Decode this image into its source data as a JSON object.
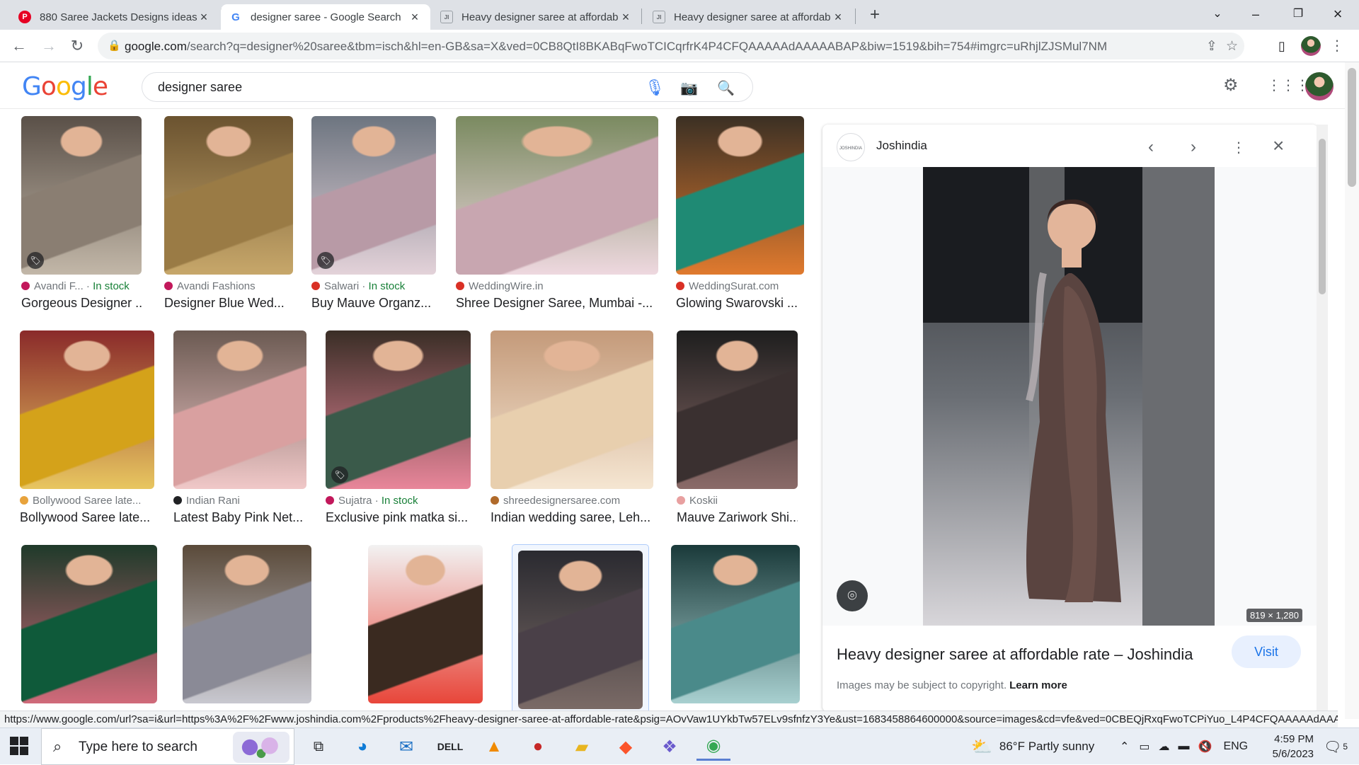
{
  "browser": {
    "tabs": [
      {
        "title": "880 Saree Jackets Designs ideas |",
        "icon": "pinterest-icon",
        "active": false
      },
      {
        "title": "designer saree - Google Search",
        "icon": "google-icon",
        "active": true
      },
      {
        "title": "Heavy designer saree at affordab",
        "icon": "joshindia-icon",
        "active": false
      },
      {
        "title": "Heavy designer saree at affordab",
        "icon": "joshindia-icon",
        "active": false
      }
    ],
    "url_host": "google.com",
    "url_rest": "/search?q=designer%20saree&tbm=isch&hl=en-GB&sa=X&ved=0CB8QtI8BKABqFwoTCICqrfrK4P4CFQAAAAAdAAAAABAP&biw=1519&bih=754#imgrc=uRhjlZJSMul7NM"
  },
  "google": {
    "logo_letters": [
      "G",
      "o",
      "o",
      "g",
      "l",
      "e"
    ],
    "logo_colors": [
      "#4285F4",
      "#EA4335",
      "#FBBC05",
      "#4285F4",
      "#34A853",
      "#EA4335"
    ],
    "query": "designer saree"
  },
  "results": [
    {
      "source": "Avandi F...",
      "stock": "In stock",
      "caption": "Gorgeous Designer ...",
      "fav": "#c2185b",
      "tag": true,
      "palette": [
        "#5a5048",
        "#8a7e72",
        "#c2b7a8"
      ]
    },
    {
      "source": "Avandi Fashions",
      "stock": "",
      "caption": "Designer Blue Wed...",
      "fav": "#c2185b",
      "tag": false,
      "palette": [
        "#6b5330",
        "#9a7b45",
        "#c7a76a"
      ]
    },
    {
      "source": "Salwari",
      "stock": "In stock",
      "caption": "Buy Mauve Organz...",
      "fav": "#d93025",
      "tag": true,
      "palette": [
        "#6d7580",
        "#b89aa6",
        "#e3d2d9"
      ]
    },
    {
      "source": "WeddingWire.in",
      "stock": "",
      "caption": "Shree Designer Saree, Mumbai -...",
      "fav": "#d93025",
      "tag": false,
      "palette": [
        "#7a8a60",
        "#c8a6b0",
        "#eed8df"
      ]
    },
    {
      "source": "WeddingSurat.com",
      "stock": "",
      "caption": "Glowing Swarovski ...",
      "fav": "#d93025",
      "tag": false,
      "palette": [
        "#3b3024",
        "#1f8a74",
        "#e07a2e"
      ]
    },
    {
      "source": "Bollywood Saree late...",
      "stock": "",
      "caption": "Bollywood Saree late...",
      "fav": "#e8a33c",
      "tag": false,
      "palette": [
        "#8a2a2a",
        "#d4a21a",
        "#e8c660"
      ]
    },
    {
      "source": "Indian Rani",
      "stock": "",
      "caption": "Latest Baby Pink Net...",
      "fav": "#202124",
      "tag": false,
      "palette": [
        "#6b5a52",
        "#d9a0a0",
        "#f0c8c8"
      ]
    },
    {
      "source": "Sujatra",
      "stock": "In stock",
      "caption": "Exclusive pink matka si...",
      "fav": "#c2185b",
      "tag": true,
      "palette": [
        "#3a2e26",
        "#3a5a4a",
        "#e8869a"
      ]
    },
    {
      "source": "shreedesignersaree.com",
      "stock": "",
      "caption": "Indian wedding saree, Leh...",
      "fav": "#b06a2a",
      "tag": false,
      "palette": [
        "#c49a7a",
        "#e8cfae",
        "#f5e6d2"
      ]
    },
    {
      "source": "Koskii",
      "stock": "",
      "caption": "Mauve Zariwork Shi...",
      "fav": "#e8a0a0",
      "tag": false,
      "palette": [
        "#1e1e1e",
        "#3a3030",
        "#8a6a68"
      ]
    },
    {
      "source": "",
      "stock": "",
      "caption": "",
      "fav": "",
      "tag": false,
      "palette": [
        "#1f3a2a",
        "#0f5a3a",
        "#d06a7a"
      ]
    },
    {
      "source": "",
      "stock": "",
      "caption": "",
      "fav": "",
      "tag": false,
      "palette": [
        "#5a4a3a",
        "#8a8a96",
        "#c8c8d0"
      ]
    },
    {
      "source": "",
      "stock": "",
      "caption": "",
      "fav": "",
      "tag": false,
      "palette": [
        "#f2f2f2",
        "#3a2a20",
        "#e8463a"
      ]
    },
    {
      "source": "",
      "stock": "",
      "caption": "",
      "fav": "",
      "tag": false,
      "palette": [
        "#2a2a30",
        "#4a4048",
        "#7a6a66"
      ],
      "selected": true
    },
    {
      "source": "",
      "stock": "",
      "caption": "",
      "fav": "",
      "tag": false,
      "palette": [
        "#1a3a3a",
        "#4a8a8a",
        "#a8d0d0"
      ]
    }
  ],
  "preview": {
    "site": "Joshindia",
    "site_logo_text": "JOSHINDIA",
    "dims": "819 × 1,280",
    "title": "Heavy designer saree at affordable rate – Joshindia",
    "visit": "Visit",
    "copyright": "Images may be subject to copyright.",
    "learn_more": "Learn more"
  },
  "status_url": "https://www.google.com/url?sa=i&url=https%3A%2F%2Fwww.joshindia.com%2Fproducts%2Fheavy-designer-saree-at-affordable-rate&psig=AOvVaw1UYkbTw57ELv9sfnfzY3Ye&ust=1683458864600000&source=images&cd=vfe&ved=0CBEQjRxqFwoTCPiYuo_L4P4CFQAAAAAdAAA...",
  "taskbar": {
    "search_placeholder": "Type here to search",
    "weather": "86°F  Partly sunny",
    "lang": "ENG",
    "time": "4:59 PM",
    "date": "5/6/2023",
    "notifications": "5"
  }
}
